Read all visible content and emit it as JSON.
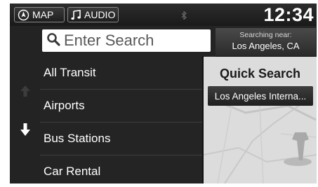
{
  "status_bar": {
    "map_label": "MAP",
    "audio_label": "AUDIO",
    "clock": "12:34"
  },
  "search": {
    "placeholder": "Enter Search"
  },
  "searching_near": {
    "label": "Searching near:",
    "value": "Los Angeles, CA"
  },
  "list": {
    "items": [
      {
        "label": "All Transit"
      },
      {
        "label": "Airports"
      },
      {
        "label": "Bus Stations"
      },
      {
        "label": "Car Rental"
      }
    ]
  },
  "quick_search": {
    "title": "Quick Search",
    "items": [
      {
        "label": "Los Angeles Interna..."
      }
    ]
  },
  "icons": [
    "map-home-icon",
    "music-note-icon",
    "bluetooth-icon",
    "search-icon",
    "arrow-up-icon",
    "arrow-down-icon"
  ],
  "colors": {
    "background": "#242424",
    "panel": "#dcdcdc",
    "text": "#ffffff"
  }
}
